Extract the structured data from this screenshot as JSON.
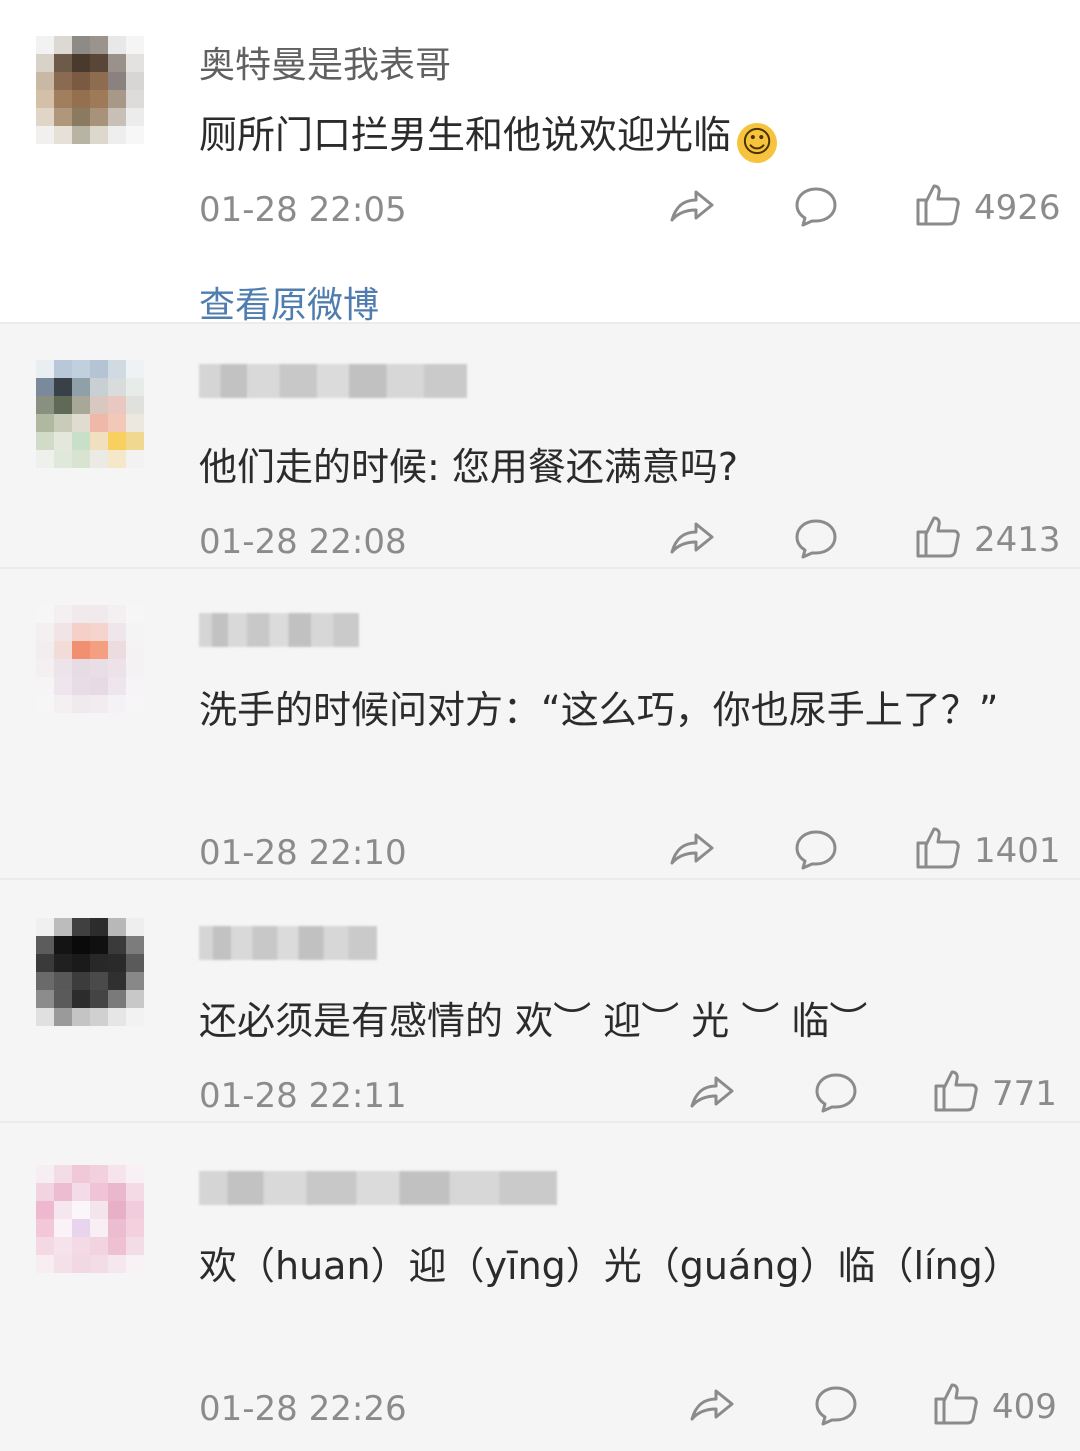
{
  "comments": [
    {
      "username": "奥特曼是我表哥",
      "text": "厕所门口拦男生和他说欢迎光临",
      "emoji": "grinning-face",
      "time": "01-28 22:05",
      "likes": "4926"
    },
    {
      "username": "",
      "text": "他们走的时候: 您用餐还满意吗?",
      "time": "01-28 22:08",
      "likes": "2413"
    },
    {
      "username": "",
      "text": "洗手的时候问对方：“这么巧，你也尿手上了？”",
      "time": "01-28 22:10",
      "likes": "1401"
    },
    {
      "username": "",
      "text": "还必须是有感情的 欢︶ 迎︶ 光 ︶ 临︶",
      "time": "01-28 22:11",
      "likes": "771"
    },
    {
      "username": "",
      "text": "欢（huan）迎（yīng）光（guáng）临（líng）",
      "time": "01-28 22:26",
      "likes": "409"
    }
  ],
  "view_original": "查看原微博",
  "icons": {
    "share": "share-arrow-icon",
    "reply": "comment-bubble-icon",
    "like": "thumbs-up-icon"
  },
  "colors": {
    "link": "#507daf",
    "meta": "#8b8b8b",
    "text": "#2b2b2b"
  }
}
